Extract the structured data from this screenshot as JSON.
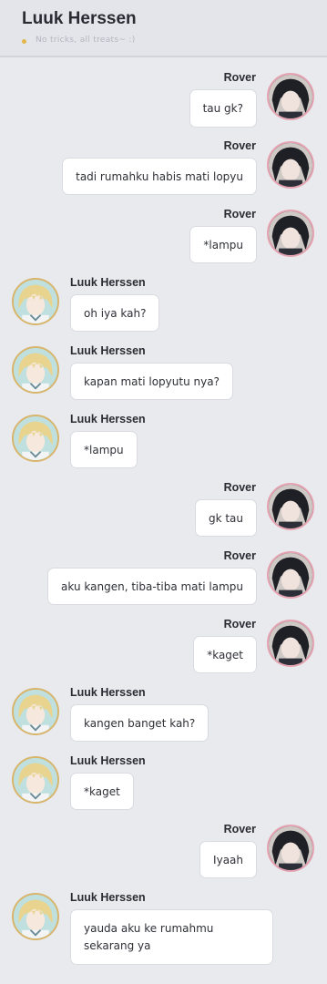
{
  "header": {
    "title": "Luuk Herssen",
    "status": "No tricks, all treats~ :)"
  },
  "messages": [
    {
      "sender": "Rover",
      "text": "tau gk?"
    },
    {
      "sender": "Rover",
      "text": "tadi rumahku habis mati lopyu"
    },
    {
      "sender": "Rover",
      "text": "*lampu"
    },
    {
      "sender": "Luuk Herssen",
      "text": "oh iya kah?"
    },
    {
      "sender": "Luuk Herssen",
      "text": "kapan mati lopyutu nya?"
    },
    {
      "sender": "Luuk Herssen",
      "text": "*lampu"
    },
    {
      "sender": "Rover",
      "text": "gk tau"
    },
    {
      "sender": "Rover",
      "text": "aku kangen, tiba-tiba mati lampu"
    },
    {
      "sender": "Rover",
      "text": "*kaget"
    },
    {
      "sender": "Luuk Herssen",
      "text": "kangen banget kah?"
    },
    {
      "sender": "Luuk Herssen",
      "text": "*kaget"
    },
    {
      "sender": "Rover",
      "text": "Iyaah"
    },
    {
      "sender": "Luuk Herssen",
      "text": "yauda aku ke rumahmu sekarang ya"
    }
  ]
}
